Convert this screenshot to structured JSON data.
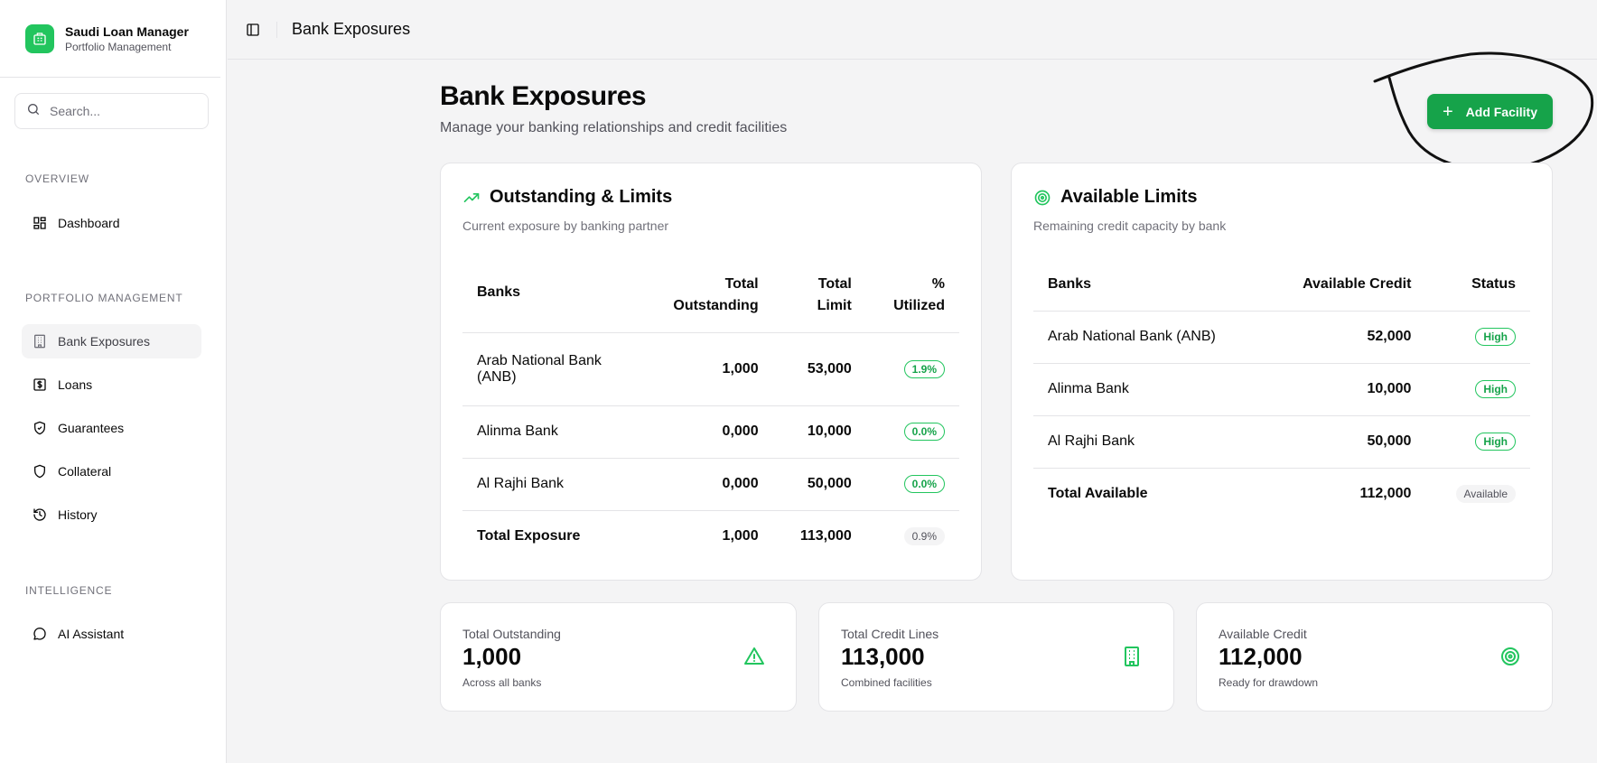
{
  "app": {
    "name": "Saudi Loan Manager",
    "subtitle": "Portfolio Management"
  },
  "search": {
    "placeholder": "Search..."
  },
  "sidebar": {
    "sections": [
      {
        "label": "OVERVIEW"
      },
      {
        "label": "PORTFOLIO MANAGEMENT"
      },
      {
        "label": "INTELLIGENCE"
      }
    ],
    "items": [
      {
        "label": "Dashboard",
        "icon": "dashboard-icon"
      },
      {
        "label": "Bank Exposures",
        "icon": "building-icon",
        "active": true
      },
      {
        "label": "Loans",
        "icon": "dollar-icon"
      },
      {
        "label": "Guarantees",
        "icon": "shield-check-icon"
      },
      {
        "label": "Collateral",
        "icon": "shield-icon"
      },
      {
        "label": "History",
        "icon": "history-icon"
      },
      {
        "label": "AI Assistant",
        "icon": "chat-icon"
      }
    ]
  },
  "topbar": {
    "title": "Bank Exposures"
  },
  "page": {
    "title": "Bank Exposures",
    "subtitle": "Manage your banking relationships and credit facilities",
    "add_button": "Add Facility"
  },
  "outstanding": {
    "title": "Outstanding & Limits",
    "description": "Current exposure by banking partner",
    "headers": {
      "bank": "Banks",
      "outstanding_1": "Total",
      "outstanding_2": "Outstanding",
      "limit_1": "Total",
      "limit_2": "Limit",
      "util_1": "%",
      "util_2": "Utilized"
    },
    "rows": [
      {
        "bank_1": "Arab National Bank",
        "bank_2": "(ANB)",
        "outstanding": "1,000",
        "limit": "53,000",
        "utilized": "1.9%"
      },
      {
        "bank_1": "Alinma Bank",
        "bank_2": "",
        "outstanding": "0,000",
        "limit": "10,000",
        "utilized": "0.0%"
      },
      {
        "bank_1": "Al Rajhi Bank",
        "bank_2": "",
        "outstanding": "0,000",
        "limit": "50,000",
        "utilized": "0.0%"
      }
    ],
    "total": {
      "label": "Total Exposure",
      "outstanding": "1,000",
      "limit": "113,000",
      "utilized": "0.9%"
    }
  },
  "available": {
    "title": "Available Limits",
    "description": "Remaining credit capacity by bank",
    "headers": {
      "bank": "Banks",
      "credit": "Available Credit",
      "status": "Status"
    },
    "rows": [
      {
        "bank": "Arab National Bank (ANB)",
        "credit": "52,000",
        "status": "High"
      },
      {
        "bank": "Alinma Bank",
        "credit": "10,000",
        "status": "High"
      },
      {
        "bank": "Al Rajhi Bank",
        "credit": "50,000",
        "status": "High"
      }
    ],
    "total": {
      "label": "Total Available",
      "credit": "112,000",
      "status": "Available"
    }
  },
  "stats": [
    {
      "label": "Total Outstanding",
      "value": "1,000",
      "sub": "Across all banks",
      "icon": "warning-icon"
    },
    {
      "label": "Total Credit Lines",
      "value": "113,000",
      "sub": "Combined facilities",
      "icon": "building-icon"
    },
    {
      "label": "Available Credit",
      "value": "112,000",
      "sub": "Ready for drawdown",
      "icon": "target-icon"
    }
  ],
  "colors": {
    "accent": "#16a34a",
    "accent_light": "#22c55e",
    "muted": "#71717a",
    "border": "#e4e4e7"
  }
}
